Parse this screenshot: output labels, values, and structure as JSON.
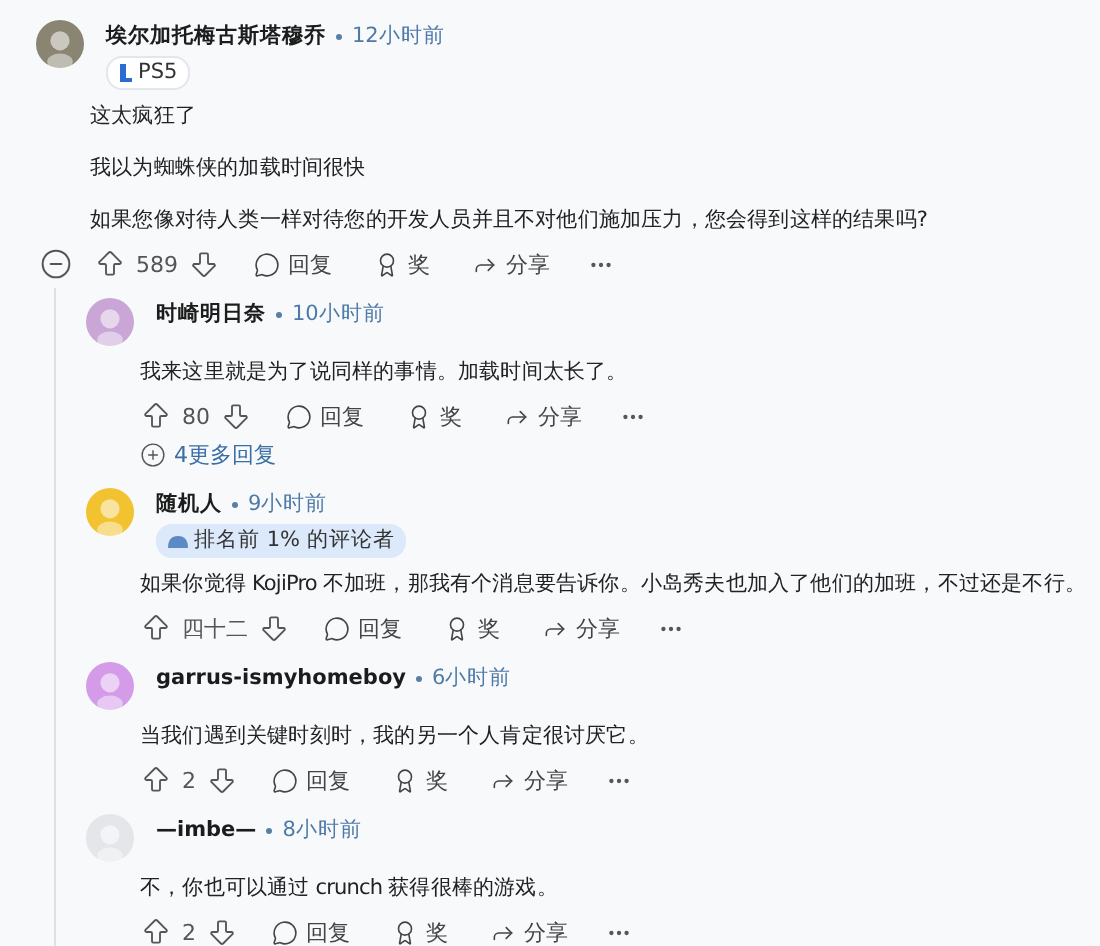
{
  "comments": [
    {
      "author": "埃尔加托梅古斯塔穆乔",
      "time": "12小时前",
      "avatar": {
        "color": "#8a8572"
      },
      "flair": {
        "kind": "platform",
        "text": "PS5"
      },
      "paragraphs": [
        "这太疯狂了",
        "我以为蜘蛛侠的加载时间很快",
        "如果您像对待人类一样对待您的开发人员并且不对他们施加压力，您会得到这样的结果吗?"
      ],
      "score": "589",
      "reply": "回复",
      "award": "奖",
      "share": "分享",
      "collapsible": true,
      "children": [
        {
          "author": "时崎明日奈",
          "time": "10小时前",
          "avatar": {
            "color": "#c9a6d6"
          },
          "paragraphs": [
            "我来这里就是为了说同样的事情。加载时间太长了。"
          ],
          "score": "80",
          "reply": "回复",
          "award": "奖",
          "share": "分享",
          "more": "4更多回复"
        },
        {
          "author": "随机人",
          "time": "9小时前",
          "avatar": {
            "color": "#f2c230"
          },
          "flair": {
            "kind": "rank",
            "text": "排名前 1% 的评论者"
          },
          "paragraphs": [
            "如果你觉得 KojiPro 不加班，那我有个消息要告诉你。小岛秀夫也加入了他们的加班，不过还是不行。"
          ],
          "score": "四十二",
          "reply": "回复",
          "award": "奖",
          "share": "分享"
        },
        {
          "author": "garrus-ismyhomeboy",
          "time": "6小时前",
          "avatar": {
            "color": "#d49be8"
          },
          "paragraphs": [
            "当我们遇到关键时刻时，我的另一个人肯定很讨厌它。"
          ],
          "score": "2",
          "reply": "回复",
          "award": "奖",
          "share": "分享"
        },
        {
          "author": "—imbe—",
          "time": "8小时前",
          "avatar": {
            "color": "#e4e6ea"
          },
          "paragraphs": [
            "不，你也可以通过 crunch 获得很棒的游戏。"
          ],
          "score": "2",
          "reply": "回复",
          "award": "奖",
          "share": "分享"
        }
      ]
    }
  ]
}
